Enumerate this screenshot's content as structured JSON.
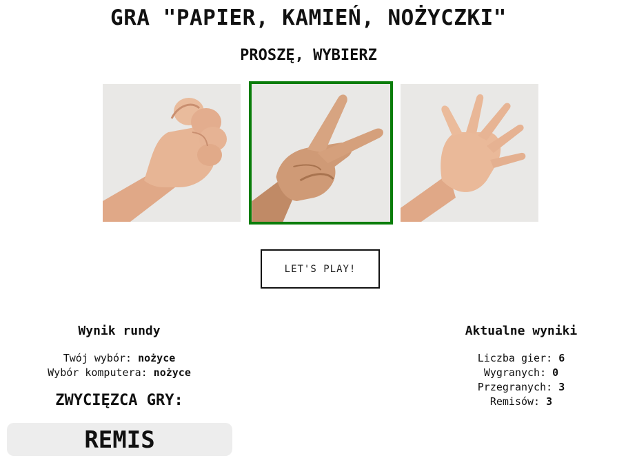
{
  "header": {
    "title": "GRA \"PAPIER, KAMIEŃ, NOŻYCZKI\"",
    "subtitle": "PROSZĘ, WYBIERZ"
  },
  "choices": [
    {
      "label": "kamień",
      "icon": "fist-hand-icon",
      "selected": false
    },
    {
      "label": "nożyce",
      "icon": "scissors-hand-icon",
      "selected": true
    },
    {
      "label": "papier",
      "icon": "open-palm-hand-icon",
      "selected": false
    }
  ],
  "play_button": {
    "label": "LET'S PLAY!"
  },
  "round_result": {
    "title": "Wynik rundy",
    "your_choice_label": "Twój wybór:",
    "your_choice_value": "nożyce",
    "computer_choice_label": "Wybór komputera:",
    "computer_choice_value": "nożyce",
    "winner_label": "ZWYCIĘZCA GRY:",
    "winner_value": "REMIS"
  },
  "current_scores": {
    "title": "Aktualne wyniki",
    "games_label": "Liczba gier:",
    "games_value": "6",
    "wins_label": "Wygranych:",
    "wins_value": "0",
    "losses_label": "Przegranych:",
    "losses_value": "3",
    "draws_label": "Remisów:",
    "draws_value": "3"
  },
  "colors": {
    "selected_border": "#0a7d0a",
    "result_box_bg": "#ededed",
    "photo_bg": "#e9e8e6",
    "skin": "#e3b08f"
  }
}
